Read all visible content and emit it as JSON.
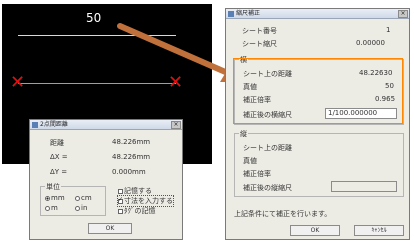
{
  "canvas": {
    "dimension_value": "50"
  },
  "measure_dialog": {
    "title": "2点間距離",
    "rows": [
      {
        "label": "距離",
        "value": "48.226mm"
      },
      {
        "label": "ΔX =",
        "value": "48.226mm"
      },
      {
        "label": "ΔY =",
        "value": "0.000mm"
      }
    ],
    "units": {
      "label": "単位",
      "options": [
        "mm",
        "cm",
        "m",
        "in"
      ],
      "selected": "mm"
    },
    "checks": [
      {
        "label": "記憶する",
        "checked": false
      },
      {
        "label": "寸法を入力する",
        "checked": true
      },
      {
        "label": "ﾀｸﾞの記憶",
        "checked": false
      }
    ],
    "ok_label": "OK"
  },
  "correction_dialog": {
    "title": "縮尺補正",
    "sheet_no_label": "シート番号",
    "sheet_no_value": "1",
    "sheet_scale_label": "シート縮尺",
    "sheet_scale_value": "0.00000",
    "horizontal": {
      "label": "横",
      "distance_label": "シート上の距離",
      "distance_value": "48.22630",
      "actual_label": "真値",
      "actual_value": "50",
      "ratio_label": "補正倍率",
      "ratio_value": "0.965",
      "scale_label": "補正後の横縮尺",
      "scale_value": "1/100.000000"
    },
    "vertical": {
      "label": "縦",
      "distance_label": "シート上の距離",
      "actual_label": "真値",
      "ratio_label": "補正倍率",
      "scale_label": "補正後の縦縮尺",
      "scale_value": ""
    },
    "message": "上記条件にて補正を行います。",
    "ok_label": "OK",
    "cancel_label": "ｷｬﾝｾﾙ"
  },
  "colors": {
    "measure_line": "#37c8d2",
    "marker": "#e01010",
    "arrow": "#c0703a",
    "highlight": "#ff8800"
  }
}
